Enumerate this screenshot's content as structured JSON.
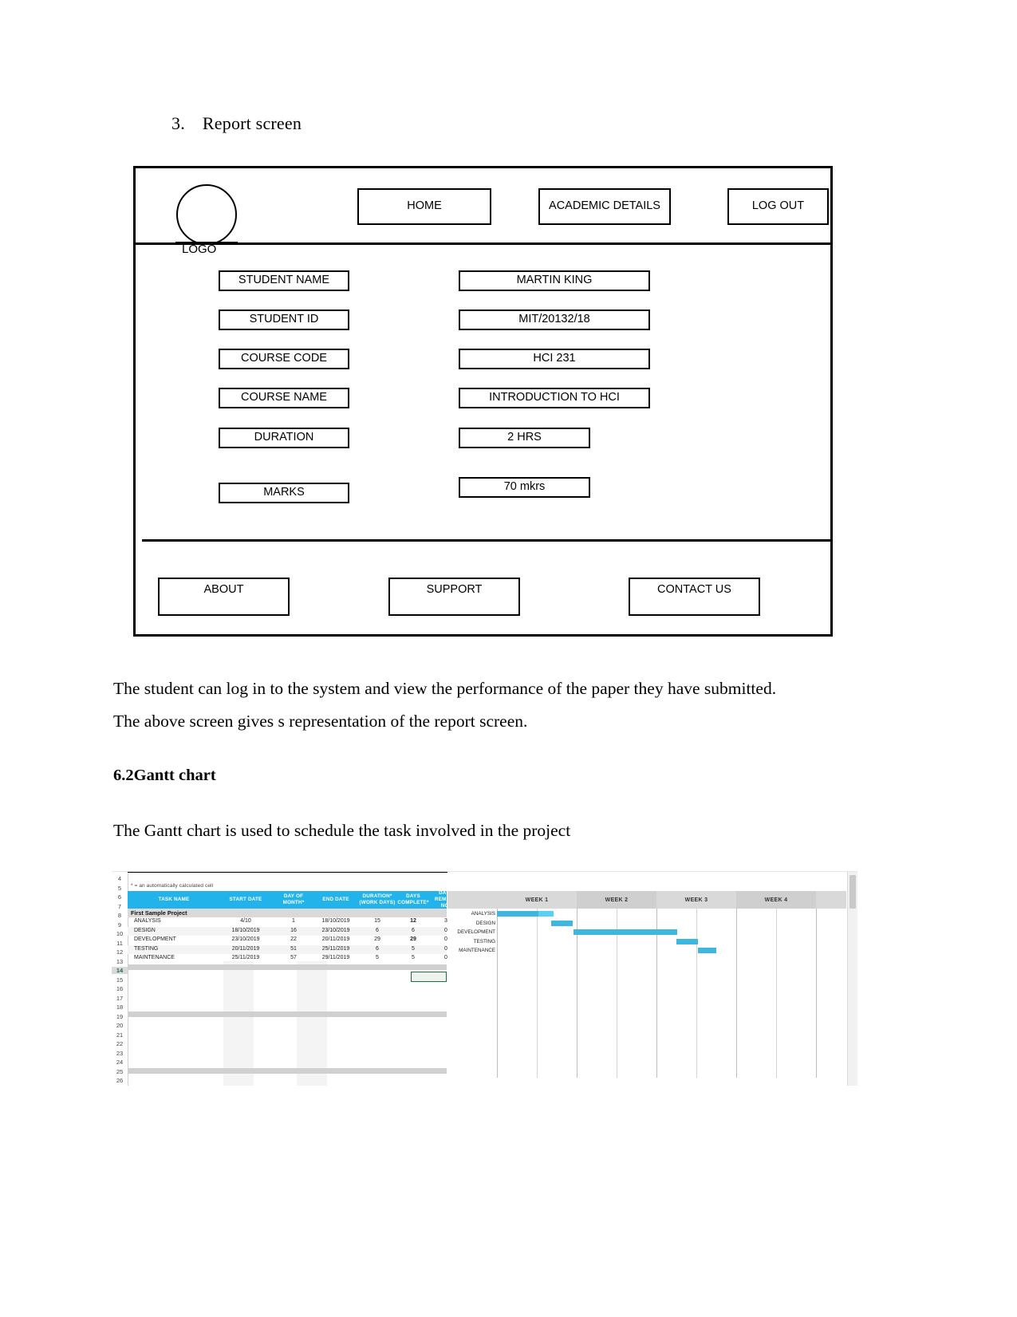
{
  "section": {
    "number": "3.",
    "title": "Report screen"
  },
  "wireframe": {
    "logo_label": "LOGO",
    "nav": [
      {
        "label": "HOME"
      },
      {
        "label": "ACADEMIC DETAILS"
      },
      {
        "label": "LOG OUT"
      }
    ],
    "fields": [
      {
        "label": "STUDENT NAME",
        "value": "MARTIN KING"
      },
      {
        "label": "STUDENT ID",
        "value": "MIT/20132/18"
      },
      {
        "label": "COURSE CODE",
        "value": "HCI 231"
      },
      {
        "label": "COURSE NAME",
        "value": "INTRODUCTION TO HCI"
      },
      {
        "label": "DURATION",
        "value": "2 HRS"
      },
      {
        "label": "MARKS",
        "value": "70 mkrs"
      }
    ],
    "footer": [
      {
        "label": "ABOUT"
      },
      {
        "label": "SUPPORT"
      },
      {
        "label": "CONTACT US"
      }
    ]
  },
  "body": {
    "paragraph1": "The student can log in to the system and view the performance of the paper they have submitted.",
    "paragraph2": "The above screen gives s representation of the report screen.",
    "heading_62": "6.2Gantt chart",
    "paragraph3": "The Gantt chart is used to schedule the task involved in the project"
  },
  "chart_data": {
    "type": "bar",
    "title": "First Sample Project",
    "note": "* = an automatically calculated cell",
    "columns": [
      "TASK NAME",
      "START DATE",
      "DAY OF MONTH*",
      "END DATE",
      "DURATION* (WORK DAYS)",
      "DAYS COMPLETE*",
      "DAYS REMAINING*"
    ],
    "column_labels_wrapped": [
      [
        "TASK NAME"
      ],
      [
        "START DATE"
      ],
      [
        "DAY OF",
        "MONTH*"
      ],
      [
        "END DATE"
      ],
      [
        "DURATION*",
        "(WORK DAYS)"
      ],
      [
        "DAYS",
        "COMPLETE*"
      ],
      [
        "DAYS",
        "REMAINI",
        "NG*"
      ]
    ],
    "categories": [
      "ANALYSIS",
      "DESIGN",
      "DEVELOPMENT",
      "TESTING",
      "MAINTENANCE"
    ],
    "rows": [
      {
        "row": "9",
        "task": "ANALYSIS",
        "start": "4/10",
        "day_of_month": "1",
        "end": "18/10/2019",
        "duration": "15",
        "complete": "12",
        "remaining": "3"
      },
      {
        "row": "10",
        "task": "DESIGN",
        "start": "18/10/2019",
        "day_of_month": "16",
        "end": "23/10/2019",
        "duration": "6",
        "complete": "6",
        "remaining": "0"
      },
      {
        "row": "11",
        "task": "DEVELOPMENT",
        "start": "23/10/2019",
        "day_of_month": "22",
        "end": "20/11/2019",
        "duration": "29",
        "complete": "29",
        "remaining": "0"
      },
      {
        "row": "12",
        "task": "TESTING",
        "start": "20/11/2019",
        "day_of_month": "51",
        "end": "25/11/2019",
        "duration": "6",
        "complete": "5",
        "remaining": "0"
      },
      {
        "row": "13",
        "task": "MAINTENANCE",
        "start": "25/11/2019",
        "day_of_month": "57",
        "end": "29/11/2019",
        "duration": "5",
        "complete": "5",
        "remaining": "0"
      }
    ],
    "week_labels": [
      "WEEK 1",
      "WEEK 2",
      "WEEK 3",
      "WEEK 4"
    ],
    "bars": [
      {
        "task": "ANALYSIS",
        "start_pct": 0.0,
        "complete_pct": 52.0,
        "total_pct": 70.5
      },
      {
        "task": "DESIGN",
        "start_pct": 68.0,
        "complete_pct": 27.0,
        "total_pct": 27.0
      },
      {
        "task": "DEVELOPMENT",
        "start_pct": 95.5,
        "complete_pct": 130.0,
        "total_pct": 130.0
      },
      {
        "task": "TESTING",
        "start_pct": 225.0,
        "complete_pct": 27.0,
        "total_pct": 27.0
      },
      {
        "task": "MAINTENANCE",
        "start_pct": 252.0,
        "complete_pct": 23.0,
        "total_pct": 23.0
      }
    ],
    "row_numbers": [
      "4",
      "5",
      "6",
      "7",
      "8",
      "9",
      "10",
      "11",
      "12",
      "13",
      "14",
      "15",
      "16",
      "17",
      "18",
      "19",
      "20",
      "21",
      "22",
      "23",
      "24",
      "25",
      "26"
    ],
    "selected_row": "14",
    "colors": {
      "header": "#21b3ea",
      "bar_complete": "#3fb6dd",
      "bar_remaining": "#5ad1f2",
      "week_band": "#d9d9d9",
      "project_band": "#d9d9d9"
    },
    "xlabel": "",
    "ylabel": "",
    "grid": true,
    "legend": "none"
  }
}
